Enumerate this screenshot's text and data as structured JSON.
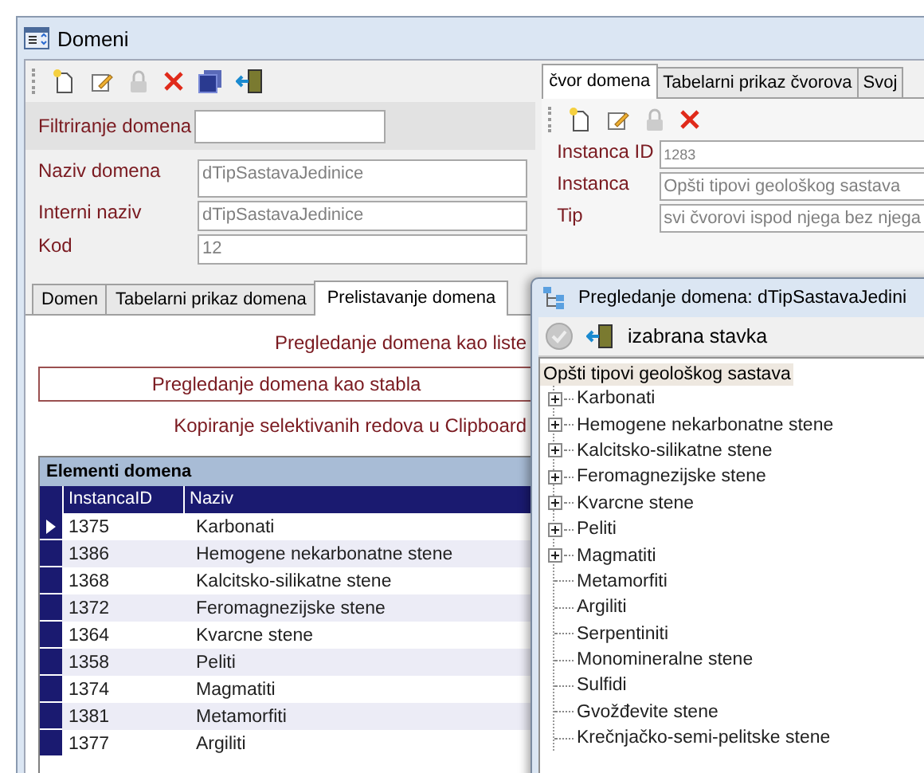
{
  "window": {
    "title": "Domeni"
  },
  "filter_label": "Filtriranje domena",
  "fields": [
    {
      "label": "Naziv domena",
      "value": "dTipSastavaJedinice"
    },
    {
      "label": "Interni naziv",
      "value": "dTipSastavaJedinice"
    },
    {
      "label": "Kod",
      "value": "12"
    }
  ],
  "left_tabs": [
    {
      "label": "Domen",
      "selected": false
    },
    {
      "label": "Tabelarni prikaz domena",
      "selected": false
    },
    {
      "label": "Prelistavanje domena",
      "selected": true
    }
  ],
  "actions": [
    {
      "label": "Pregledanje domena kao liste",
      "focused": false
    },
    {
      "label": "Pregledanje domena kao stabla",
      "focused": true
    },
    {
      "label": "Kopiranje selektivanih redova u Clipboard",
      "focused": false
    }
  ],
  "grid": {
    "title": "Elementi domena",
    "columns": [
      "InstancaID",
      "Naziv"
    ],
    "rows": [
      {
        "cells": [
          "1375",
          "Karbonati"
        ],
        "selected": true
      },
      {
        "cells": [
          "1386",
          "Hemogene nekarbonatne stene"
        ],
        "selected": false
      },
      {
        "cells": [
          "1368",
          "Kalcitsko-silikatne stene"
        ],
        "selected": false
      },
      {
        "cells": [
          "1372",
          "Feromagnezijske stene"
        ],
        "selected": false
      },
      {
        "cells": [
          "1364",
          "Kvarcne stene"
        ],
        "selected": false
      },
      {
        "cells": [
          "1358",
          "Peliti"
        ],
        "selected": false
      },
      {
        "cells": [
          "1374",
          "Magmatiti"
        ],
        "selected": false
      },
      {
        "cells": [
          "1381",
          "Metamorfiti"
        ],
        "selected": false
      },
      {
        "cells": [
          "1377",
          "Argiliti"
        ],
        "selected": false
      }
    ]
  },
  "right_tabs": [
    {
      "label": "čvor domena",
      "selected": true
    },
    {
      "label": "Tabelarni prikaz čvorova",
      "selected": false
    },
    {
      "label": "Svoj",
      "selected": false
    }
  ],
  "node_fields": [
    {
      "label": "Instanca ID",
      "value": "1283"
    },
    {
      "label": "Instanca",
      "value": "Opšti tipovi geološkog sastava"
    },
    {
      "label": "Tip",
      "value": "svi čvorovi ispod njega bez njega"
    }
  ],
  "dialog": {
    "title": "Pregledanje domena: dTipSastavaJedini",
    "toolbar_label": "izabrana stavka",
    "tree": {
      "label": "Opšti tipovi geološkog sastava",
      "selected": true,
      "children": [
        {
          "label": "Karbonati",
          "expandable": true
        },
        {
          "label": "Hemogene nekarbonatne stene",
          "expandable": true
        },
        {
          "label": "Kalcitsko-silikatne stene",
          "expandable": true
        },
        {
          "label": "Feromagnezijske stene",
          "expandable": true
        },
        {
          "label": "Kvarcne stene",
          "expandable": true
        },
        {
          "label": "Peliti",
          "expandable": true
        },
        {
          "label": "Magmatiti",
          "expandable": true
        },
        {
          "label": "Metamorfiti",
          "expandable": false
        },
        {
          "label": "Argiliti",
          "expandable": false
        },
        {
          "label": "Serpentiniti",
          "expandable": false
        },
        {
          "label": "Monomineralne stene",
          "expandable": false
        },
        {
          "label": "Sulfidi",
          "expandable": false
        },
        {
          "label": "Gvožđevite stene",
          "expandable": false
        },
        {
          "label": "Krečnjačko-semi-pelitske stene",
          "expandable": false
        }
      ]
    }
  }
}
